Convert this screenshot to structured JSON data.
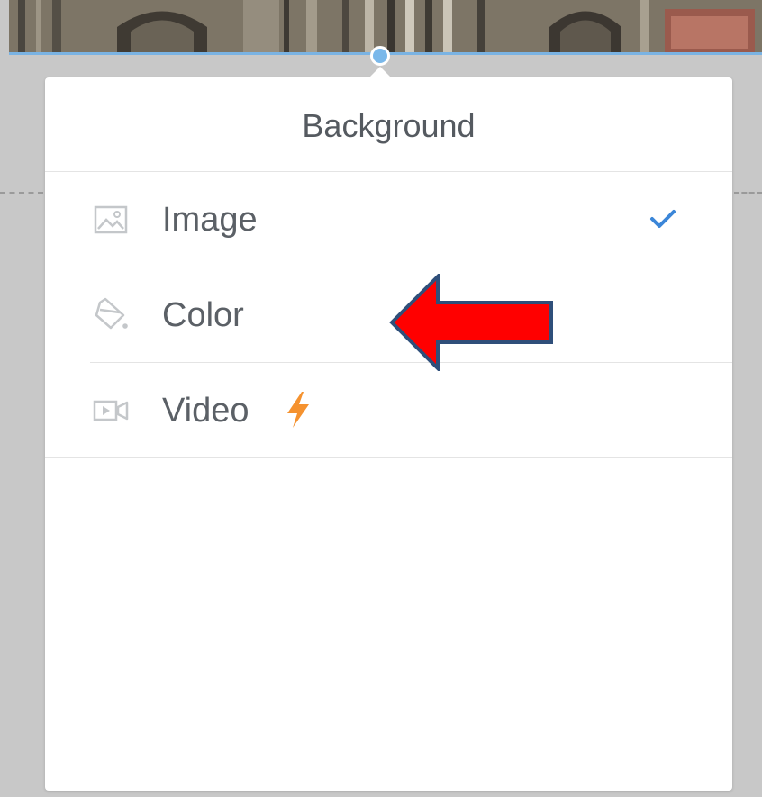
{
  "panel": {
    "title": "Background"
  },
  "options": [
    {
      "label": "Image",
      "icon": "image-icon",
      "selected": true
    },
    {
      "label": "Color",
      "icon": "paint-bucket-icon",
      "selected": false
    },
    {
      "label": "Video",
      "icon": "video-icon",
      "selected": false,
      "badge_icon": "lightning-bolt-icon"
    }
  ],
  "colors": {
    "accent_blue": "#3b86d8",
    "bolt_orange": "#f5922f",
    "arrow_red": "#ff0000",
    "arrow_outline": "#2f4f7a",
    "handle_blue": "#7ab8ea"
  },
  "annotation": {
    "icon": "red-left-arrow"
  }
}
